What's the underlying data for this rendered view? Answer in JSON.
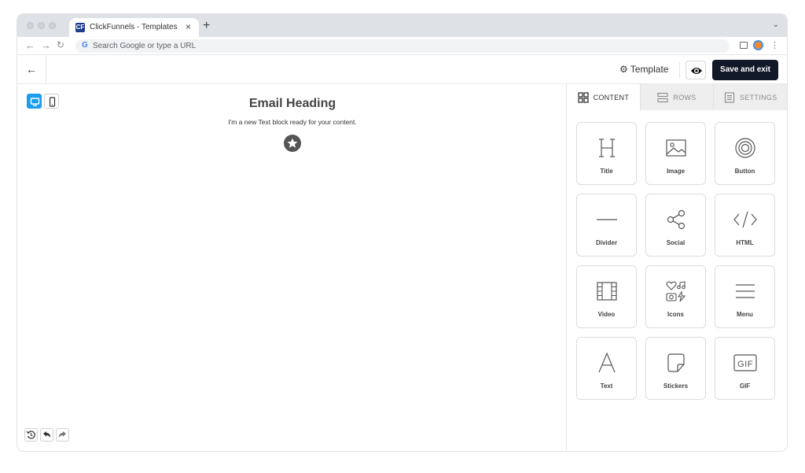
{
  "browser": {
    "tab_title": "ClickFunnels - Templates",
    "tab_close": "×",
    "new_tab": "+",
    "favicon_text": "CF",
    "omnibox_placeholder": "Search Google or type a URL",
    "google_g": "G"
  },
  "header": {
    "back_arrow": "←",
    "template_label": "Template",
    "save_label": "Save and exit"
  },
  "canvas": {
    "heading": "Email Heading",
    "text": "I'm a new Text block ready for your content."
  },
  "panel": {
    "tabs": [
      {
        "label": "CONTENT",
        "icon": "grid-icon",
        "active": true
      },
      {
        "label": "ROWS",
        "icon": "rows-icon",
        "active": false
      },
      {
        "label": "SETTINGS",
        "icon": "settings-icon",
        "active": false
      }
    ],
    "blocks": [
      {
        "label": "Title",
        "icon": "title-icon"
      },
      {
        "label": "Image",
        "icon": "image-icon"
      },
      {
        "label": "Button",
        "icon": "button-icon"
      },
      {
        "label": "Divider",
        "icon": "divider-icon"
      },
      {
        "label": "Social",
        "icon": "share-icon"
      },
      {
        "label": "HTML",
        "icon": "code-icon"
      },
      {
        "label": "Video",
        "icon": "film-icon"
      },
      {
        "label": "Icons",
        "icon": "icons-icon"
      },
      {
        "label": "Menu",
        "icon": "menu-icon"
      },
      {
        "label": "Text",
        "icon": "text-icon"
      },
      {
        "label": "Stickers",
        "icon": "sticker-icon"
      },
      {
        "label": "GIF",
        "icon": "gif-icon"
      }
    ]
  },
  "colors": {
    "accent": "#1a9df0",
    "save_button": "#111827"
  }
}
